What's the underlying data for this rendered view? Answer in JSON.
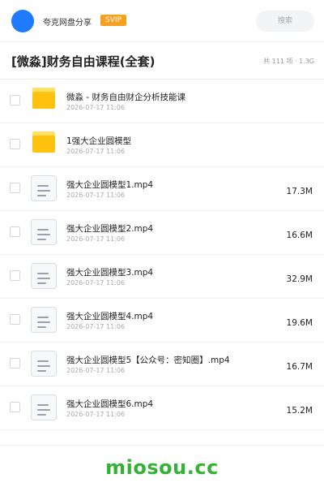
{
  "header": {
    "user_name": "夸克网盘分享",
    "badge": "SVIP",
    "search_placeholder": "搜索",
    "avatar_color": "#1e7bff"
  },
  "share": {
    "title": "[微淼]财务自由课程(全套)",
    "summary": "共 111 项 · 1.3G"
  },
  "files": [
    {
      "type": "folder",
      "icon": "folder-icon",
      "name": "微淼 - 财务自由财企分析技能课",
      "date": "2026-07-17 11:06",
      "size": ""
    },
    {
      "type": "folder",
      "icon": "folder-icon",
      "name": "1强大企业圆模型",
      "date": "2026-07-17 11:06",
      "size": ""
    },
    {
      "type": "file",
      "icon": "document-icon",
      "name": "强大企业圆模型1.mp4",
      "date": "2026-07-17 11:06",
      "size": "17.3M"
    },
    {
      "type": "file",
      "icon": "document-icon",
      "name": "强大企业圆模型2.mp4",
      "date": "2026-07-17 11:06",
      "size": "16.6M"
    },
    {
      "type": "file",
      "icon": "document-icon",
      "name": "强大企业圆模型3.mp4",
      "date": "2026-07-17 11:06",
      "size": "32.9M"
    },
    {
      "type": "file",
      "icon": "document-icon",
      "name": "强大企业圆模型4.mp4",
      "date": "2026-07-17 11:06",
      "size": "19.6M"
    },
    {
      "type": "file",
      "icon": "document-icon",
      "name": "强大企业圆模型5【公众号：密知圈】.mp4",
      "date": "2026-07-17 11:06",
      "size": "16.7M"
    },
    {
      "type": "file",
      "icon": "document-icon",
      "name": "强大企业圆模型6.mp4",
      "date": "2026-07-17 11:06",
      "size": "15.2M"
    }
  ],
  "watermark": "miosou.cc",
  "colors": {
    "svip": "#f5a020",
    "folder": "#ffc20e",
    "watermark": "#34b233"
  }
}
